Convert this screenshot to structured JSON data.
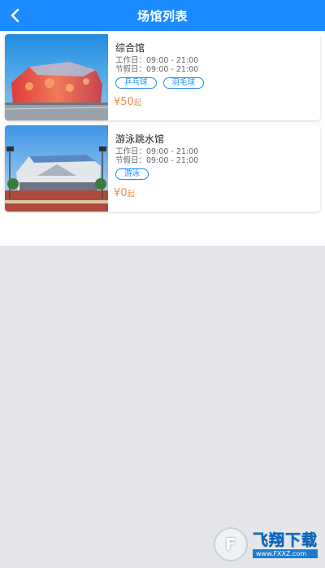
{
  "header": {
    "title": "场馆列表",
    "back_icon": "chevron-left-icon",
    "background_color": "#1a8cff"
  },
  "venues": [
    {
      "name": "综合馆",
      "workday": "工作日：09:00 - 21:00",
      "holiday": "节假日：09:00 - 21:00",
      "tags": [
        "乒乓球",
        "羽毛球"
      ],
      "price_symbol": "¥",
      "price": "50",
      "price_unit": "起"
    },
    {
      "name": "游泳跳水馆",
      "workday": "工作日：09:00 - 21:00",
      "holiday": "节假日：09:00 - 21:00",
      "tags": [
        "游泳"
      ],
      "price_symbol": "¥",
      "price": "0",
      "price_unit": "起"
    }
  ],
  "watermark": {
    "logo_glyph": "F",
    "text": "飞翔下载",
    "url": "www.FXXZ.com"
  },
  "colors": {
    "accent": "#1a8cff",
    "price": "#f08a4b",
    "page_background": "#e4e6ea"
  }
}
